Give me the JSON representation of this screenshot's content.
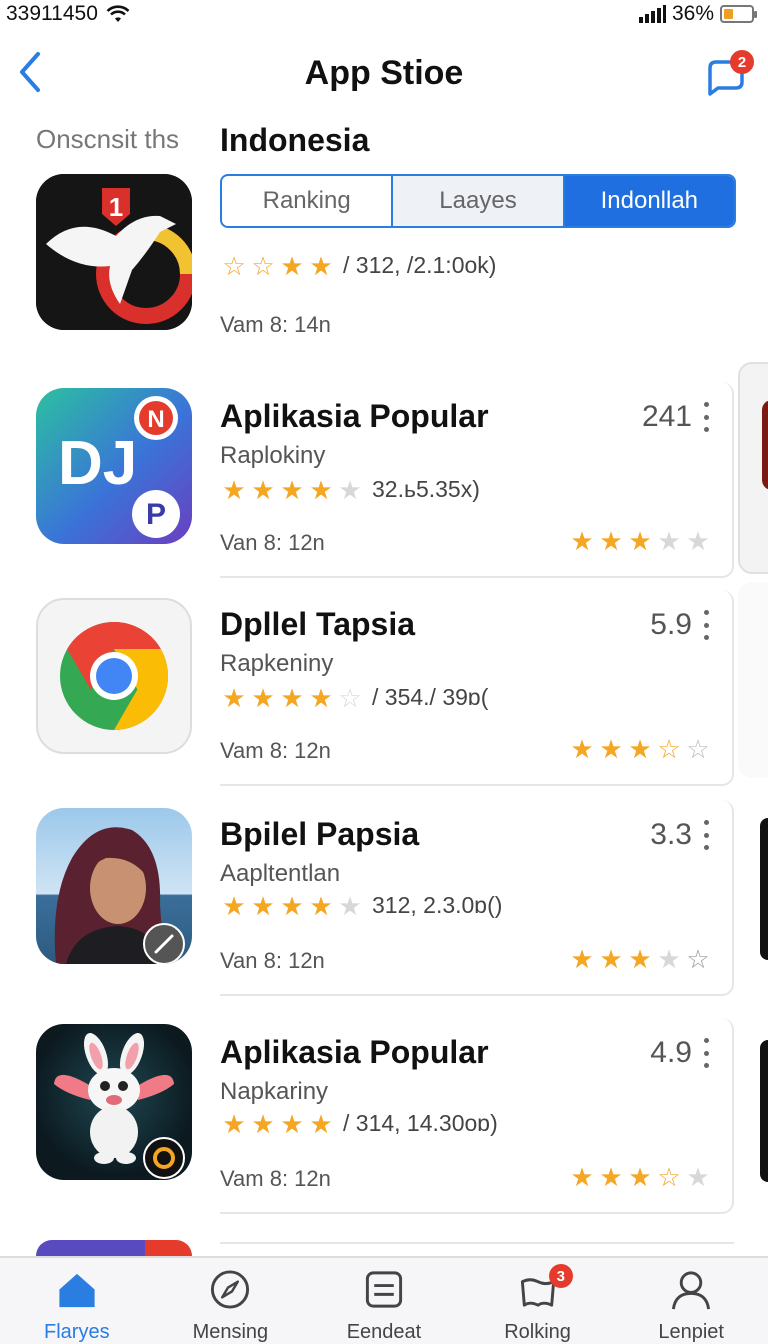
{
  "status": {
    "time": "33911450",
    "battery_pct": "36%",
    "battery_level": 0.36
  },
  "nav": {
    "title": "App Stioe",
    "chat_badge": "2"
  },
  "section": {
    "left_label": "Onscnsit ths",
    "title": "Indonesia"
  },
  "segments": [
    {
      "label": "Ranking",
      "active": false
    },
    {
      "label": "Laayes",
      "active": false
    },
    {
      "label": "Indonllah",
      "active": true
    }
  ],
  "featured": {
    "rating_stars": 4,
    "rating_text": "/ 312, /2.1:0ok)",
    "time": "Vam 8: 14n",
    "badge": "1"
  },
  "apps": [
    {
      "name": "Aplikasia Popular",
      "subtitle": "Raplokiny",
      "rating_stars": 4,
      "rating_text": "32.ь5.35x)",
      "time": "Van 8: 12n",
      "score": "241",
      "right_stars": 3,
      "icon": "dj-app-icon"
    },
    {
      "name": "Dpllel Tapsia",
      "subtitle": "Rapkeniny",
      "rating_stars": 4,
      "rating_text": "/ 354./ 39ɒ(",
      "time": "Vam 8: 12n",
      "score": "5.9",
      "right_stars": 3,
      "icon": "chrome-icon"
    },
    {
      "name": "Bpilel Papsia",
      "subtitle": "Aapltentlan",
      "rating_stars": 4,
      "rating_text": "312, 2.3.0ɒ()",
      "time": "Van 8: 12n",
      "score": "3.3",
      "right_stars": 3,
      "icon": "portrait-icon"
    },
    {
      "name": "Aplikasia Popular",
      "subtitle": "Napkariny",
      "rating_stars": 4,
      "rating_text": "/ 314, 14.30oɒ)",
      "time": "Vam 8: 12n",
      "score": "4.9",
      "right_stars": 3,
      "icon": "creature-icon"
    }
  ],
  "tabs": [
    {
      "label": "Flaryes",
      "icon": "home-icon",
      "active": true
    },
    {
      "label": "Mensing",
      "icon": "compass-icon",
      "active": false
    },
    {
      "label": "Eendeat",
      "icon": "list-icon",
      "active": false
    },
    {
      "label": "Rolking",
      "icon": "bag-icon",
      "active": false,
      "badge": "3"
    },
    {
      "label": "Lenpiet",
      "icon": "person-icon",
      "active": false
    }
  ],
  "colors": {
    "accent": "#1f6fe0",
    "star": "#f5a623",
    "badge": "#e53b2c"
  }
}
